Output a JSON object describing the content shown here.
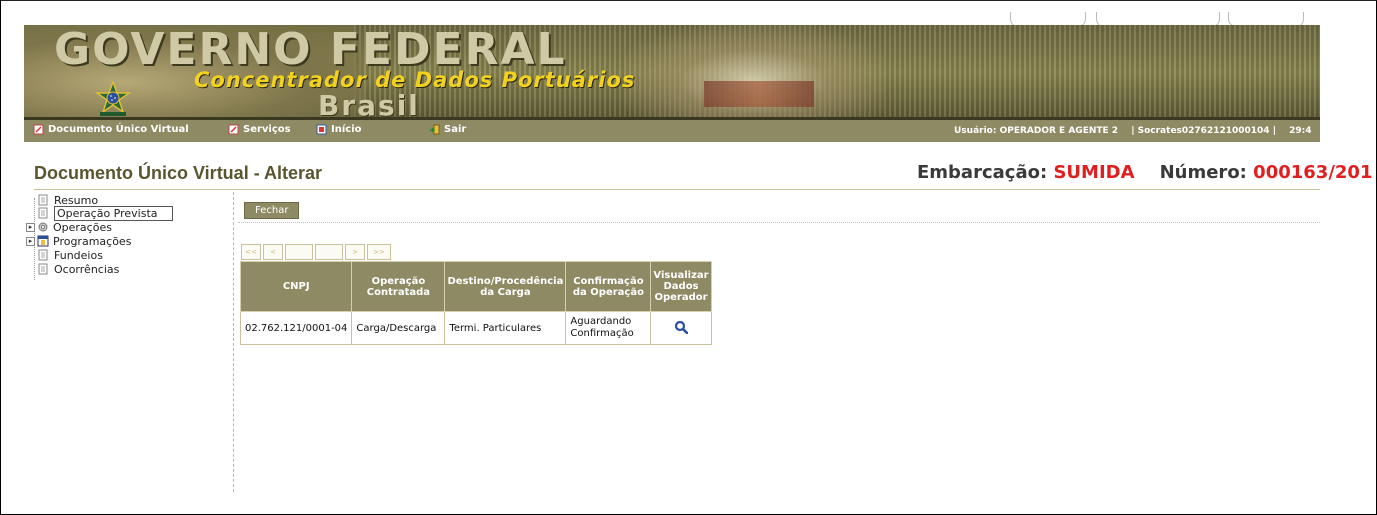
{
  "header": {
    "title": "GOVERNO FEDERAL",
    "subtitle": "Concentrador de Dados Portuários",
    "country": "Brasil"
  },
  "menu": {
    "items": [
      {
        "label": "Documento Único Virtual",
        "icon": "document-icon"
      },
      {
        "label": "Serviços",
        "icon": "services-icon"
      },
      {
        "label": "Início",
        "icon": "home-icon"
      },
      {
        "label": "Sair",
        "icon": "exit-icon"
      }
    ],
    "user_label": "Usuário: OPERADOR E AGENTE 2",
    "session_id": "| Socrates02762121000104 |",
    "timer": "29:4"
  },
  "page": {
    "title": "Documento Único Virtual - Alterar",
    "vessel_label": "Embarcação:",
    "vessel_name": "SUMIDA",
    "number_label": "Número:",
    "number_value": "000163/201"
  },
  "tree": [
    {
      "label": "Resumo",
      "icon": "page-icon",
      "expandable": false
    },
    {
      "label": "Operação Prevista",
      "icon": "page-icon",
      "expandable": false,
      "selected": true
    },
    {
      "label": "Operações",
      "icon": "gear-icon",
      "expandable": true
    },
    {
      "label": "Programações",
      "icon": "calendar-icon",
      "expandable": true
    },
    {
      "label": "Fundeios",
      "icon": "page-icon",
      "expandable": false
    },
    {
      "label": "Ocorrências",
      "icon": "page-icon",
      "expandable": false
    }
  ],
  "toolbar": {
    "close_label": "Fechar"
  },
  "pager": {
    "first": "<<",
    "prev": "<",
    "next": ">",
    "last": ">>"
  },
  "table": {
    "headers": [
      "CNPJ",
      "Operação Contratada",
      "Destino/Procedência da Carga",
      "Confirmação da Operação",
      "Visualizar Dados Operador"
    ],
    "rows": [
      {
        "cnpj": "02.762.121/0001-04",
        "operacao": "Carga/Descarga",
        "destino": "Termi. Particulares",
        "confirmacao": "Aguardando Confirmação",
        "action_icon": "magnifier-icon"
      }
    ]
  },
  "colors": {
    "accent": "#8e8a64",
    "title": "#5a552f",
    "highlight": "#e02020",
    "subtitle": "#f2d21e"
  }
}
